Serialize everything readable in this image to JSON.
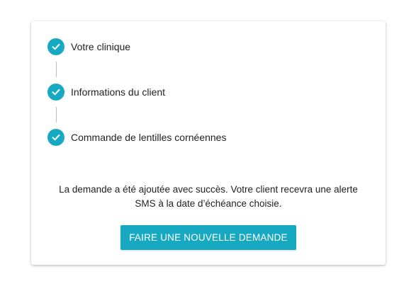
{
  "stepper": {
    "steps": [
      {
        "label": "Votre clinique",
        "status": "completed",
        "icon": "check-icon"
      },
      {
        "label": "Informations du client",
        "status": "completed",
        "icon": "check-icon"
      },
      {
        "label": "Commande de lentilles cornéennes",
        "status": "completed",
        "icon": "check-icon"
      }
    ]
  },
  "confirmation": {
    "line1": "La demande a été ajoutée avec succès. Votre client recevra une alerte",
    "line2": "SMS à la date d’échéance choisie."
  },
  "actions": {
    "new_request_label": "FAIRE UNE NOUVELLE DEMANDE"
  },
  "colors": {
    "accent": "#17a9c1",
    "text": "#222222",
    "connector": "#bdbdbd"
  }
}
